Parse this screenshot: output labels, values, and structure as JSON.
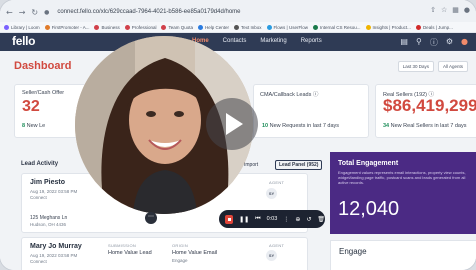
{
  "browser": {
    "url": "connect.fello.co/xlc/629ccaad-7964-4021-b586-ee85a0179d4d/home",
    "bookmarks": [
      "Library | Loom",
      "FirstPromoter - A...",
      "Business",
      "Professional",
      "Team Quota",
      "Help Center",
      "Text Inbox",
      "Flows | UserFlow",
      "Internal CS Resou...",
      "Insights | Product...",
      "Deals | Jump..."
    ]
  },
  "app": {
    "logo": "fello",
    "nav": [
      "Home",
      "Contacts",
      "Marketing",
      "Reports"
    ],
    "active_nav": "Home"
  },
  "dashboard": {
    "title": "Dashboard",
    "filters": [
      "Last 30 Days",
      "All Agents"
    ],
    "cards": {
      "seller_cash": {
        "label": "Seller/Cash Offer",
        "value": "32",
        "note_num": "8",
        "note_text": "New Le"
      },
      "cma": {
        "label": "CMA/Callback Leads ⓘ",
        "value": "",
        "note_num": "10",
        "note_text": "New Requests in last 7 days"
      },
      "real_sellers": {
        "label": "Real Sellers (192) ⓘ",
        "value": "$86,419,299",
        "note_num": "34",
        "note_text": "New Real Sellers in last 7 days"
      }
    },
    "lead_activity": {
      "title": "Lead Activity",
      "tabs": [
        "Import",
        "Lead Panel (952)"
      ],
      "rows": [
        {
          "name": "Jim Piesto",
          "sub": "Aug 19, 2022 03:58 PM",
          "status": "Connect",
          "address": "125 Meghans Ln",
          "city": "Hudson, OH 4436",
          "agent_label": "AGENT",
          "agent": "SY"
        },
        {
          "name": "Mary Jo Murray",
          "sub": "Aug 19, 2022 03:58 PM",
          "status": "Connect",
          "sub_label": "SUBMISSION",
          "submission": "Home Value Lead",
          "origin_label": "ORIGIN",
          "origin": "Home Value Email",
          "origin_sub": "Engage",
          "agent_label": "AGENT",
          "agent": "SY"
        }
      ]
    },
    "engagement": {
      "title": "Total Engagement",
      "desc": "Engagement values represents email interactions, property view counts, widget/landing page traffic, postcard scans and leads generated from all active records.",
      "value": "12,040"
    },
    "engage_section": "Engage"
  },
  "video": {
    "time": "0:03"
  }
}
